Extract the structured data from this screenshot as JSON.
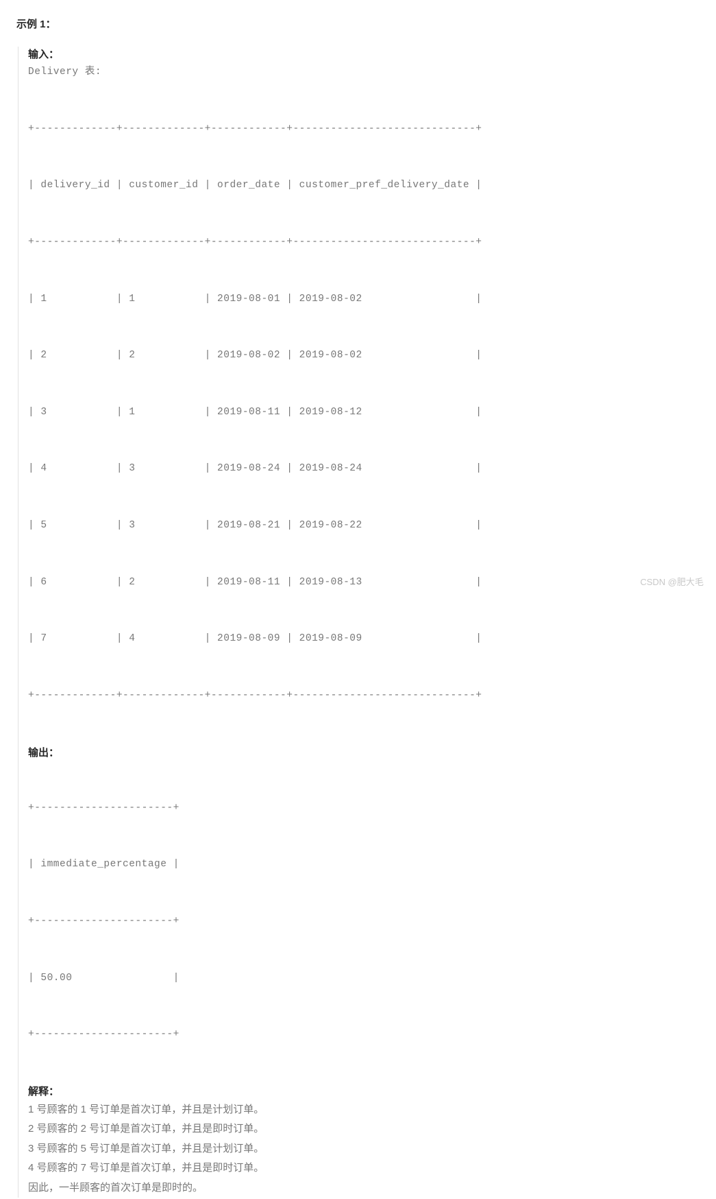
{
  "title": "示例 1：",
  "input_label": "输入：",
  "delivery_table_caption": "Delivery 表:",
  "delivery_table": {
    "top_border": "+-------------+-------------+------------+-----------------------------+",
    "header_row": "| delivery_id | customer_id | order_date | customer_pref_delivery_date |",
    "header_sep": "+-------------+-------------+------------+-----------------------------+",
    "rows": [
      "| 1           | 1           | 2019-08-01 | 2019-08-02                  |",
      "| 2           | 2           | 2019-08-02 | 2019-08-02                  |",
      "| 3           | 1           | 2019-08-11 | 2019-08-12                  |",
      "| 4           | 3           | 2019-08-24 | 2019-08-24                  |",
      "| 5           | 3           | 2019-08-21 | 2019-08-22                  |",
      "| 6           | 2           | 2019-08-11 | 2019-08-13                  |",
      "| 7           | 4           | 2019-08-09 | 2019-08-09                  |"
    ],
    "bottom_border": "+-------------+-------------+------------+-----------------------------+"
  },
  "output_label": "输出：",
  "output_table": {
    "top_border": "+----------------------+",
    "header_row": "| immediate_percentage |",
    "header_sep": "+----------------------+",
    "value_row": "| 50.00                |",
    "bottom_border": "+----------------------+"
  },
  "explain_label": "解释：",
  "explain_lines": [
    "1 号顾客的 1 号订单是首次订单，并且是计划订单。",
    "2 号顾客的 2 号订单是首次订单，并且是即时订单。",
    "3 号顾客的 5 号订单是首次订单，并且是计划订单。",
    "4 号顾客的 7 号订单是首次订单，并且是即时订单。",
    "因此，一半顾客的首次订单是即时的。"
  ],
  "watermark": "CSDN @肥大毛"
}
